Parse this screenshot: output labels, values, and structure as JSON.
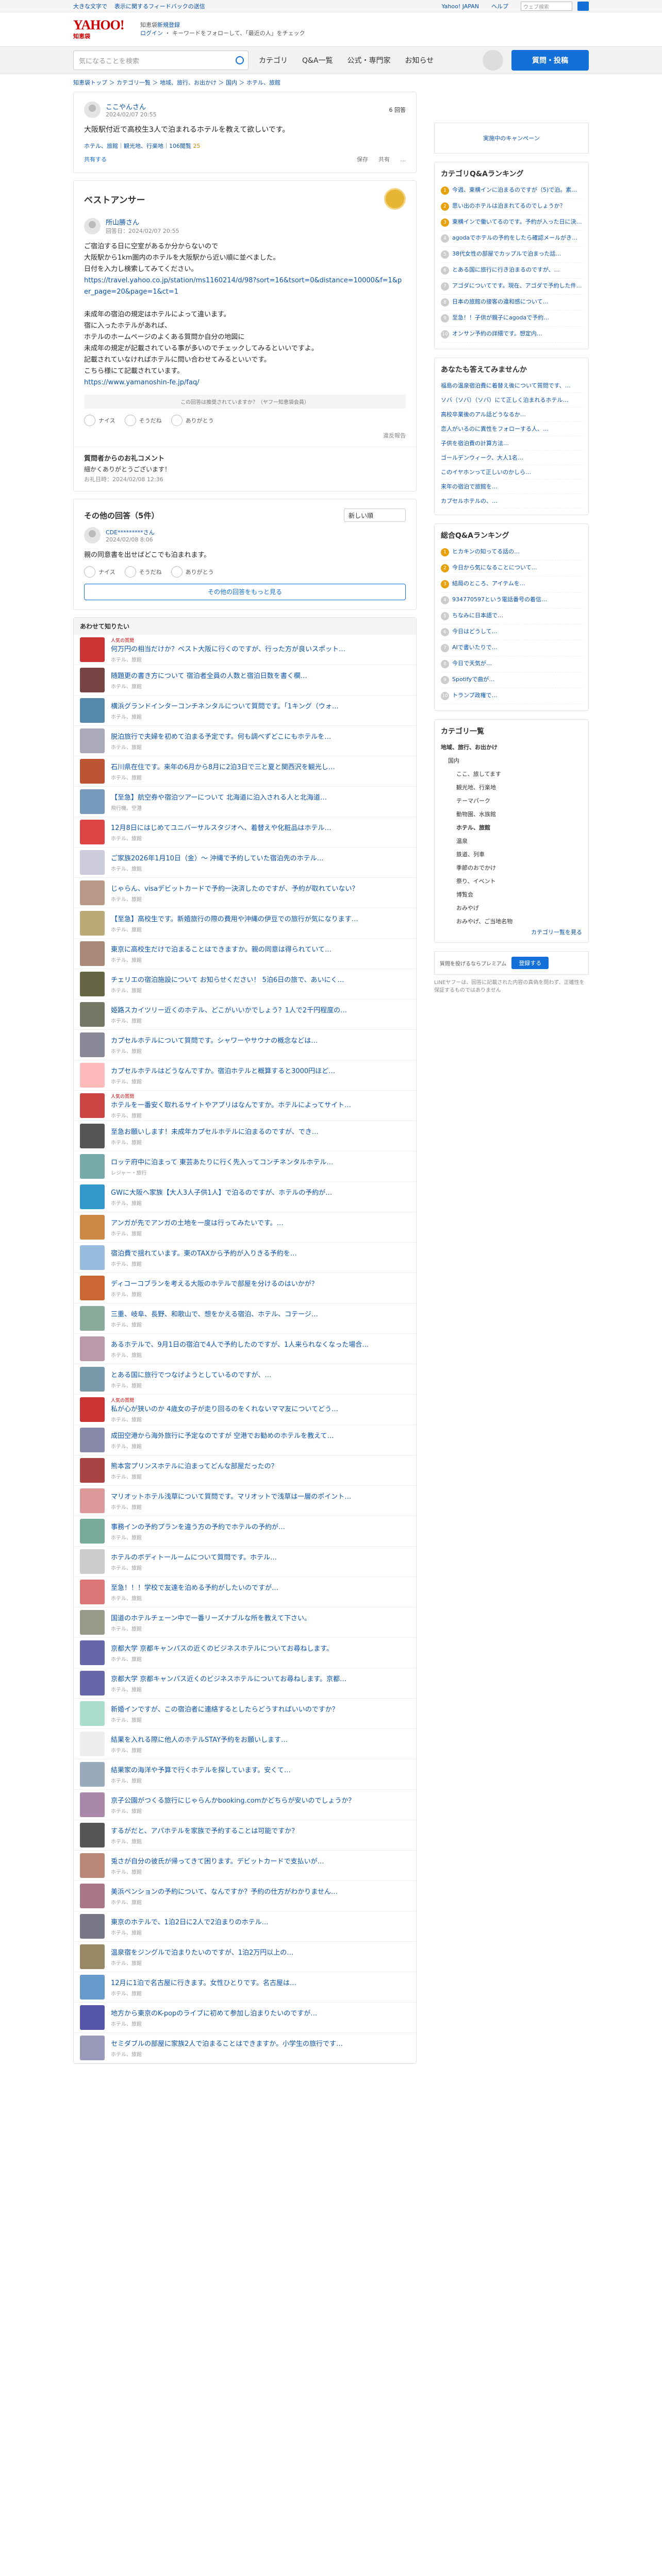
{
  "topbar": {
    "left": [
      "大きな文字で",
      "表示に関するフィードバックの送信"
    ],
    "links": [
      "Yahoo! JAPAN",
      "ヘルプ"
    ],
    "search_ph": "ウェブ検索"
  },
  "header": {
    "logo": "YAHOO!",
    "logo_sub": "知恵袋",
    "line1": "知恵袋",
    " u": "",
    "line1b": "さんで",
    "line1link": "新規登録",
    "line2": "ログイン",
    "line3": "キーワードをフォローして、「最近の人」をチェック"
  },
  "search": {
    "placeholder": "気になることを検索"
  },
  "nav": [
    "カテゴリ",
    "Q&A一覧",
    "公式・専門家",
    "お知らせ"
  ],
  "ask_label": "質問・投稿",
  "breadcrumb": "知恵袋トップ ＞ カテゴリ一覧 ＞ 地域、旅行、お出かけ ＞ 国内 ＞ ホテル、旅館",
  "question": {
    "user": "ここやんさん",
    "date": "2024/02/07 20:55",
    "answers_count": "6 回答",
    "text": "大阪駅付近で高校生3人で泊まれるホテルを教えて欲しいです。",
    "tags": "ホテル、旅館｜観光地、行楽地｜106閲覧",
    "coin": "25",
    "share": "共有する",
    "save": "保存",
    "view": "共有",
    "more": "…"
  },
  "best": {
    "title": "ベストアンサー",
    "user": "所山勝さん",
    "label": "回答日",
    "date": "2024/02/07 20:55",
    "lines": [
      "ご宿泊する日に空室があるか分からないので",
      "大阪駅から1km圏内のホテルを大阪駅から近い順に並べました。",
      "日付を入力し検索してみてください。",
      "https://travel.yahoo.co.jp/station/ms1160214/d/98?sort=16&tsort=0&distance=10000&f=1&per_page=20&page=1&ct=1",
      "",
      "未成年の宿泊の規定はホテルによって違います。",
      "宿に入ったホテルがあれば、",
      "ホテルのホームページのよくある質問か自分の地図に",
      "未成年の規定が記載されている事が多いのでチェックしてみるといいですよ。",
      "記載されていなければホテルに問い合わせてみるといいです。",
      "こちら様にて記載されています。",
      "https://www.yamanoshin-fe.jp/faq/"
    ],
    "note": "この回答は推奨されていますか？（ヤフー知恵袋会員）",
    "r1": "ナイス",
    "r2": "そうだね",
    "r3": "ありがとう",
    "report": "違反報告"
  },
  "thanks": {
    "title": "質問者からのお礼コメント",
    "text": "細かくありがとうございます！",
    "date": "お礼日時：2024/02/08 12:36"
  },
  "others": {
    "title": "その他の回答（5件）",
    "sort": "新しい順",
    "user": "CDE*********さん",
    "date": "2024/02/08 8:06",
    "text": "親の同意書を出せばどこでも泊まれます。",
    "reactions": [
      "ナイス",
      "そうだね",
      "ありがとう"
    ],
    "more": "その他の回答をもっと見る"
  },
  "related_title": "あわせて知りたい",
  "related": [
    {
      "t": "何万円の相当だけか？ベスト大阪に行くのですが、行った方が良いスポット…",
      "s": "ホテル、旅館",
      "pr": "人気の質問",
      "c": "#c33"
    },
    {
      "t": "随題更の書き方について 宿泊者全員の人数と宿泊日数を書く欄…",
      "s": "ホテル、旅館",
      "c": "#744"
    },
    {
      "t": "横浜グランドインターコンチネンタルについて質問です。「1キング（ウォ…",
      "s": "ホテル、旅館",
      "c": "#58a"
    },
    {
      "t": "脱泊旅行で夫婦を初めて泊まる予定です。何も調べずどこにもホテルを…",
      "s": "ホテル、旅館",
      "c": "#aab"
    },
    {
      "t": "石川県在住です。来年の6月から8月に2泊3日で三と夏と関西沢を観光し…",
      "s": "ホテル、旅館",
      "c": "#b53"
    },
    {
      "t": "【至急】航空券や宿泊ツアーについて 北海道に泊入される人と北海道…",
      "s": "飛行機、空港",
      "c": "#79b"
    },
    {
      "t": "12月8日にはじめてユニバーサルスタジオへ、着替えや化粧品はホテル…",
      "s": "ホテル、旅館",
      "c": "#d44"
    },
    {
      "t": "ご家族2026年1月10日（金）～ 沖縄で予約していた宿泊先のホテル…",
      "s": "ホテル、旅館",
      "c": "#ccd"
    },
    {
      "t": "じゃらん、visaデビットカードで予約一決済したのですが、予約が取れていない？",
      "s": "ホテル、旅館",
      "c": "#b98"
    },
    {
      "t": "【至急】高校生です。新婚旅行の際の費用や沖縄の伊豆での旅行が気になります…",
      "s": "ホテル、旅館",
      "c": "#ba7"
    },
    {
      "t": "東京に高校生だけで泊まることはできますか。親の同意は得られていて…",
      "s": "ホテル、旅館",
      "c": "#a87"
    },
    {
      "t": "チェリエの宿泊施設について お知らせください！ 5泊6日の旅で、あいにく…",
      "s": "ホテル、旅館",
      "c": "#664"
    },
    {
      "t": "姫路スカイツリー近くのホテル、どこがいいかでしょう？1人で2千円程度の…",
      "s": "ホテル、旅館",
      "c": "#776"
    },
    {
      "t": "カプセルホテルについて質問です。シャワーやサウナの概念などは…",
      "s": "ホテル、旅館",
      "c": "#889"
    },
    {
      "t": "カプセルホテルはどうなんですか。宿泊ホテルと概算すると3000円ほど…",
      "s": "ホテル、旅館",
      "c": "#fbb"
    },
    {
      "t": "ホテルを一番安く取れるサイトやアプリはなんですか。ホテルによってサイト…",
      "s": "ホテル、旅館",
      "pr": "人気の質問",
      "c": "#c44"
    },
    {
      "t": "至急お願いします！未成年カプセルホテルに泊まるのですが、でき…",
      "s": "ホテル、旅館",
      "c": "#555"
    },
    {
      "t": "ロッテ府中に泊まって 東芸あたりに行く先入ってコンチネンタルホテル…",
      "s": "レジャー・旅行",
      "c": "#7aa"
    },
    {
      "t": "GWに大阪へ家族【大人3人子供1人】で泊るのですが、ホテルの予約が…",
      "s": "ホテル、旅館",
      "c": "#39c"
    },
    {
      "t": "アンガが先でアンガの土地を一度は行ってみたいです。…",
      "s": "ホテル、旅館",
      "c": "#c84"
    },
    {
      "t": "宿泊費で揺れています。東のTAXから予約が入りきる予約を…",
      "s": "ホテル、旅館",
      "c": "#9bd"
    },
    {
      "t": "ディコーコブランを考える大阪のホテルで部屋を分けるのはいかが？",
      "s": "ホテル、旅館",
      "c": "#c63"
    },
    {
      "t": "三重、岐阜、長野、和歌山で、想をかえる宿泊、ホテル、コテージ…",
      "s": "ホテル、旅館",
      "c": "#8a9"
    },
    {
      "t": "あるホテルで、9月1日の宿泊で4人で予約したのですが、1人来られなくなった場合…",
      "s": "ホテル、旅館",
      "c": "#b9a"
    },
    {
      "t": "とある国に旅行でつなげようとしているのですが、…",
      "s": "ホテル、旅館",
      "c": "#79a"
    },
    {
      "t": "私が心が狭いのか 4歳女の子が走り回るのをくれないママ友についてどう…",
      "s": "ホテル、旅館",
      "pr": "人気の質問",
      "c": "#c33"
    },
    {
      "t": "成田空港から海外旅行に予定なのですが 空港でお勧めのホテルを教えて…",
      "s": "ホテル、旅館",
      "c": "#88a"
    },
    {
      "t": "熊本宮プリンスホテルに泊まってどんな部屋だったの？",
      "s": "ホテル、旅館",
      "c": "#a44"
    },
    {
      "t": "マリオットホテル浅草について質問です。マリオットで浅草は一層のポイント…",
      "s": "ホテル、旅館",
      "c": "#d99"
    },
    {
      "t": "事務インの予約プランを違う方の予約でホテルの予約が…",
      "s": "ホテル、旅館",
      "c": "#7a9"
    },
    {
      "t": "ホテルのボディトールームについて質問です。ホテル…",
      "s": "ホテル、旅館",
      "c": "#ccc"
    },
    {
      "t": "至急！！！学校で友達を泊める予約がしたいのですが…",
      "s": "ホテル、旅館",
      "c": "#d77"
    },
    {
      "t": "国道のホテルチェーン中で一番リーズナブルな所を教えて下さい。",
      "s": "ホテル、旅館",
      "c": "#998"
    },
    {
      "t": "京都大学 京都キャンパスの近くのビジネスホテルについてお尋ねします。",
      "s": "ホテル、旅館",
      "c": "#66a"
    },
    {
      "t": "京都大学 京都キャンパス近くのビジネスホテルについてお尋ねします。京都…",
      "s": "ホテル、旅館",
      "c": "#66a"
    },
    {
      "t": "新婚インですが、この宿泊者に連絡するとしたらどうすればいいのですか？",
      "s": "ホテル、旅館",
      "c": "#adc"
    },
    {
      "t": "結果を入れる際に他人のホテルSTAY予約をお願いします…",
      "s": "ホテル、旅館",
      "c": "#eee"
    },
    {
      "t": "結果家の海洋や予算で行くホテルを探しています。安くて…",
      "s": "ホテル、旅館",
      "c": "#9ab"
    },
    {
      "t": "京子公園がつくる旅行にじゃらんかbooking.comかどちらが安いのでしょうか？",
      "s": "ホテル、旅館",
      "c": "#a8a"
    },
    {
      "t": "するがだと、アパホテルを家族で予約することは可能ですか？",
      "s": "ホテル、旅館",
      "c": "#555"
    },
    {
      "t": "兎さが自分の彼氏が帰ってきて困ります。デビットカードで支払いが…",
      "s": "ホテル、旅館",
      "c": "#b87"
    },
    {
      "t": "美浜ペンションの予約について、なんですか？予約の仕方がわかりません…",
      "s": "ホテル、旅館",
      "c": "#a78"
    },
    {
      "t": "東京のホテルで、1泊2日に2人で2泊まりのホテル…",
      "s": "ホテル、旅館",
      "c": "#778"
    },
    {
      "t": "温泉宿をジングルで泊まりたいのですが、1泊2万円以上の…",
      "s": "ホテル、旅館",
      "c": "#986"
    },
    {
      "t": "12月に1泊で名古屋に行きます。女性ひとりです。名古屋は…",
      "s": "ホテル、旅館",
      "c": "#69c"
    },
    {
      "t": "地方から東京のK-popのライブに初めて参加し泊まりたいのですが…",
      "s": "ホテル、旅館",
      "c": "#55a"
    },
    {
      "t": "セミダブルの部屋に家族2人で泊まることはできますか。小学生の旅行です…",
      "s": "ホテル、旅館",
      "c": "#99b"
    }
  ],
  "side": {
    "ad": "実施中のキャンペーン",
    "cat_rank_title": "カテゴリQ&Aランキング",
    "cat_rank": [
      "今週、東横インに泊まるのですが（5)で泊。素朴の朝食を見てみたい",
      "思い出のホテルは泊まれてるのでしょうか？",
      "東横インで働いてるのです。予約が入った日に決まらない旅も...",
      "agodaでホテルの予約をしたら確認メールがきません",
      "38代女性の部屋でカップルで泊まった話…",
      "とある国に旅行に行き泊まるのですが、…",
      "アゴダについてです。現在、アゴダで予約した件で…",
      "日本の旅館の接客の違和感について…",
      "至急！！子供が親子にagodaで予約…",
      "オンサン予約の詳細です。想定内…"
    ],
    "think_title": "あなたも答えてみませんか",
    "think": [
      "福島の温泉宿泊費に着替え後について質問です、…",
      "ソバ（ソバ）（ソバ）にて正しく泊まれるホテル…",
      "高校卒業後のアル話どうなるか…",
      "恋人がいるのに異性をフォローする人、…",
      "子供を宿泊費の計算方法…",
      "ゴールデンウィーク、大人1名…",
      "このイヤホンって正しいのかしら…",
      "来年の宿泊で旅館を…",
      "カプセルホテルの、…"
    ],
    "total_rank_title": "総合Q&Aランキング",
    "total_rank": [
      "ヒカキンの知ってる話の…",
      "今日から気になることについて…",
      "結局のところ、アイテムを…",
      "934770597という電話番号の着信…",
      "ちなみに日本語で…",
      "今日はどうして…",
      "AIで書いたりで…",
      "今日で天気が…",
      "Spotifyで曲が…",
      "トランプ政権で…"
    ],
    "category_title": "カテゴリ一覧",
    "categories": [
      "地域、旅行、お出かけ",
      "国内",
      "ここ、旅してます",
      "観光地、行楽地",
      "テーマパーク",
      "動物園、水族館",
      "ホテル、旅館",
      "温泉",
      "鉄道、列車",
      "季節のおでかけ",
      "祭り、イベント",
      "博覧会",
      "おみやげ",
      "おみやげ、ご当地名物"
    ],
    "cat_link": "カテゴリ一覧を見る",
    "premium_text": "質問を投げるならプレミアム",
    "premium_btn": "登録する",
    "note": "LINEヤフーは、回答に記載された内容の真偽を問わず、正確性を保証するものではありません"
  }
}
